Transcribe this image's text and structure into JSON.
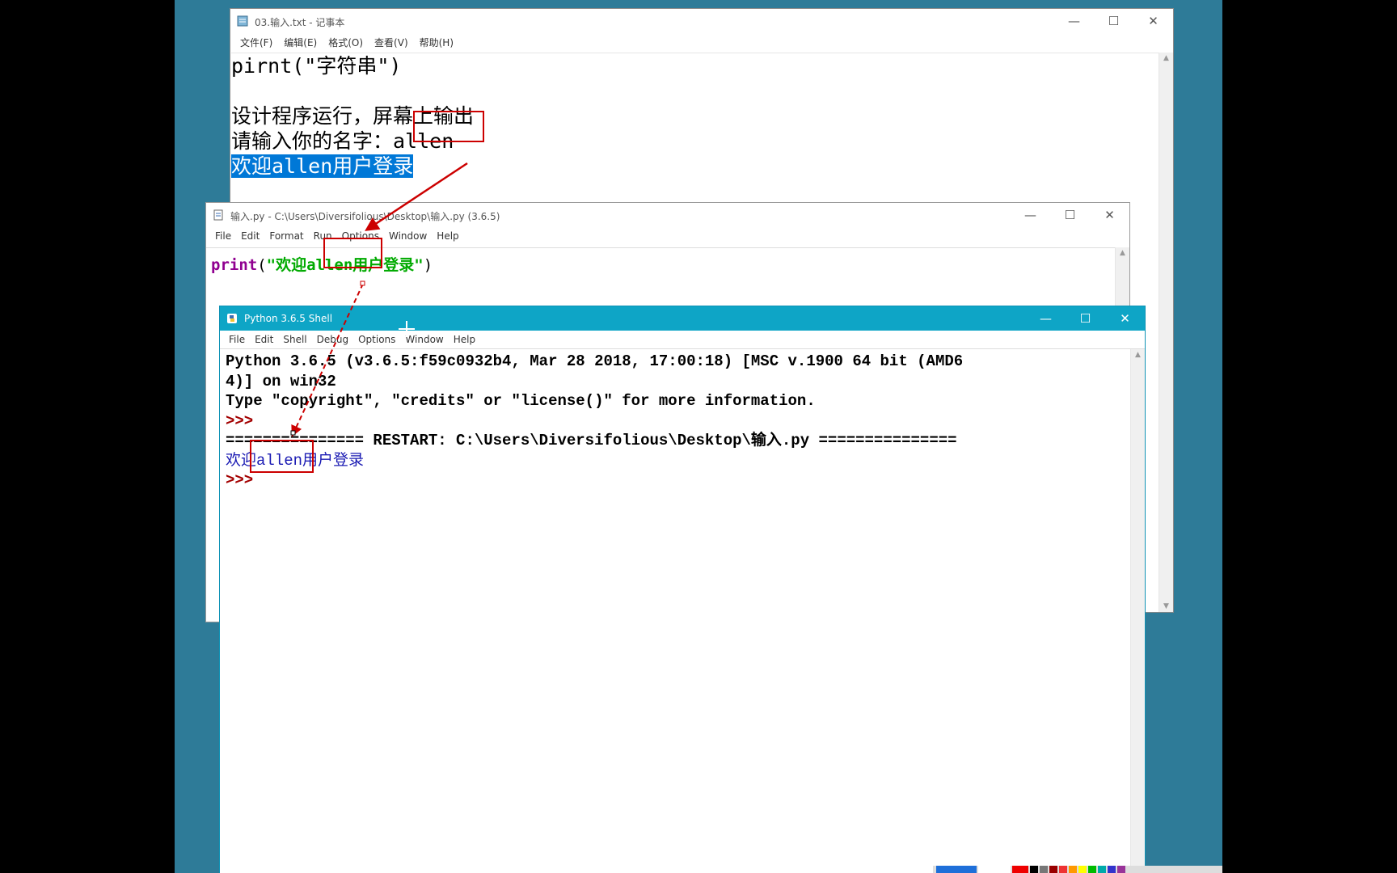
{
  "notepad": {
    "title": "03.输入.txt - 记事本",
    "menus": [
      "文件(F)",
      "编辑(E)",
      "格式(O)",
      "查看(V)",
      "帮助(H)"
    ],
    "lines": [
      "pirnt(\"字符串\")",
      "",
      "设计程序运行，屏幕上输出",
      "请输入你的名字：allen",
      "欢迎allen用户登录"
    ]
  },
  "editor": {
    "title": "输入.py - C:\\Users\\Diversifolious\\Desktop\\输入.py (3.6.5)",
    "menus": [
      "File",
      "Edit",
      "Format",
      "Run",
      "Options",
      "Window",
      "Help"
    ],
    "code_keyword": "print",
    "code_open": "(",
    "code_string": "\"欢迎allen用户登录\"",
    "code_close": ")"
  },
  "shell": {
    "title": "Python 3.6.5 Shell",
    "menus": [
      "File",
      "Edit",
      "Shell",
      "Debug",
      "Options",
      "Window",
      "Help"
    ],
    "line1": "Python 3.6.5 (v3.6.5:f59c0932b4, Mar 28 2018, 17:00:18) [MSC v.1900 64 bit (AMD6",
    "line2": "4)] on win32",
    "line3": "Type \"copyright\", \"credits\" or \"license()\" for more information.",
    "prompt": ">>>",
    "restart": "=============== RESTART: C:\\Users\\Diversifolious\\Desktop\\输入.py ===============",
    "output": "欢迎allen用户登录"
  },
  "controls": {
    "minimize": "—",
    "maximize": "☐",
    "close": "✕"
  },
  "colors": {
    "desktop": "#2e7b98",
    "shell_titlebar": "#0ea5c6",
    "annotation_red": "#cc0000",
    "selection": "#0078d7"
  }
}
